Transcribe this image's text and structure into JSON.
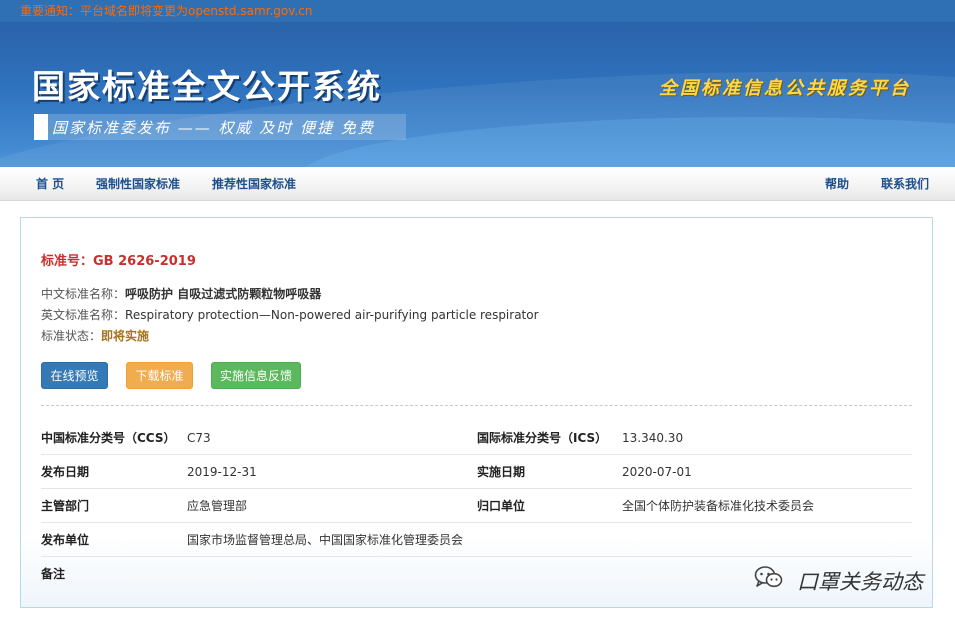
{
  "notice": {
    "text": "重要通知：平台域名即将变更为openstd.samr.gov.cn"
  },
  "banner": {
    "title": "国家标准全文公开系统",
    "subtitle": "国家标准委发布 —— 权威 及时 便捷 免费",
    "slogan": "全国标准信息公共服务平台"
  },
  "nav": {
    "home": "首 页",
    "mandatory": "强制性国家标准",
    "recommended": "推荐性国家标准",
    "help": "帮助",
    "contact": "联系我们"
  },
  "standard": {
    "number_label": "标准号：",
    "number": "GB 2626-2019",
    "cn_name_label": "中文标准名称：",
    "cn_name": "呼吸防护 自吸过滤式防颗粒物呼吸器",
    "en_name_label": "英文标准名称：",
    "en_name": "Respiratory protection—Non-powered air-purifying particle respirator",
    "status_label": "标准状态：",
    "status": "即将实施"
  },
  "buttons": {
    "preview": "在线预览",
    "download": "下载标准",
    "feedback": "实施信息反馈"
  },
  "meta": {
    "ccs_label": "中国标准分类号（CCS）",
    "ccs": "C73",
    "ics_label": "国际标准分类号（ICS）",
    "ics": "13.340.30",
    "pub_date_label": "发布日期",
    "pub_date": "2019-12-31",
    "impl_date_label": "实施日期",
    "impl_date": "2020-07-01",
    "dept_label": "主管部门",
    "dept": "应急管理部",
    "owner_label": "归口单位",
    "owner": "全国个体防护装备标准化技术委员会",
    "publisher_label": "发布单位",
    "publisher": "国家市场监督管理总局、中国国家标准化管理委员会",
    "remark_label": "备注",
    "remark": ""
  },
  "watermark": {
    "text": "口罩关务动态",
    "icon": "wechat-icon"
  },
  "colors": {
    "banner_blue": "#2f72bd",
    "notice_orange": "#ff6a00",
    "std_red": "#c9302c",
    "status_brown": "#a5741f",
    "btn_blue": "#337ab7",
    "btn_orange": "#f0ad4e",
    "btn_green": "#5cb85c"
  }
}
